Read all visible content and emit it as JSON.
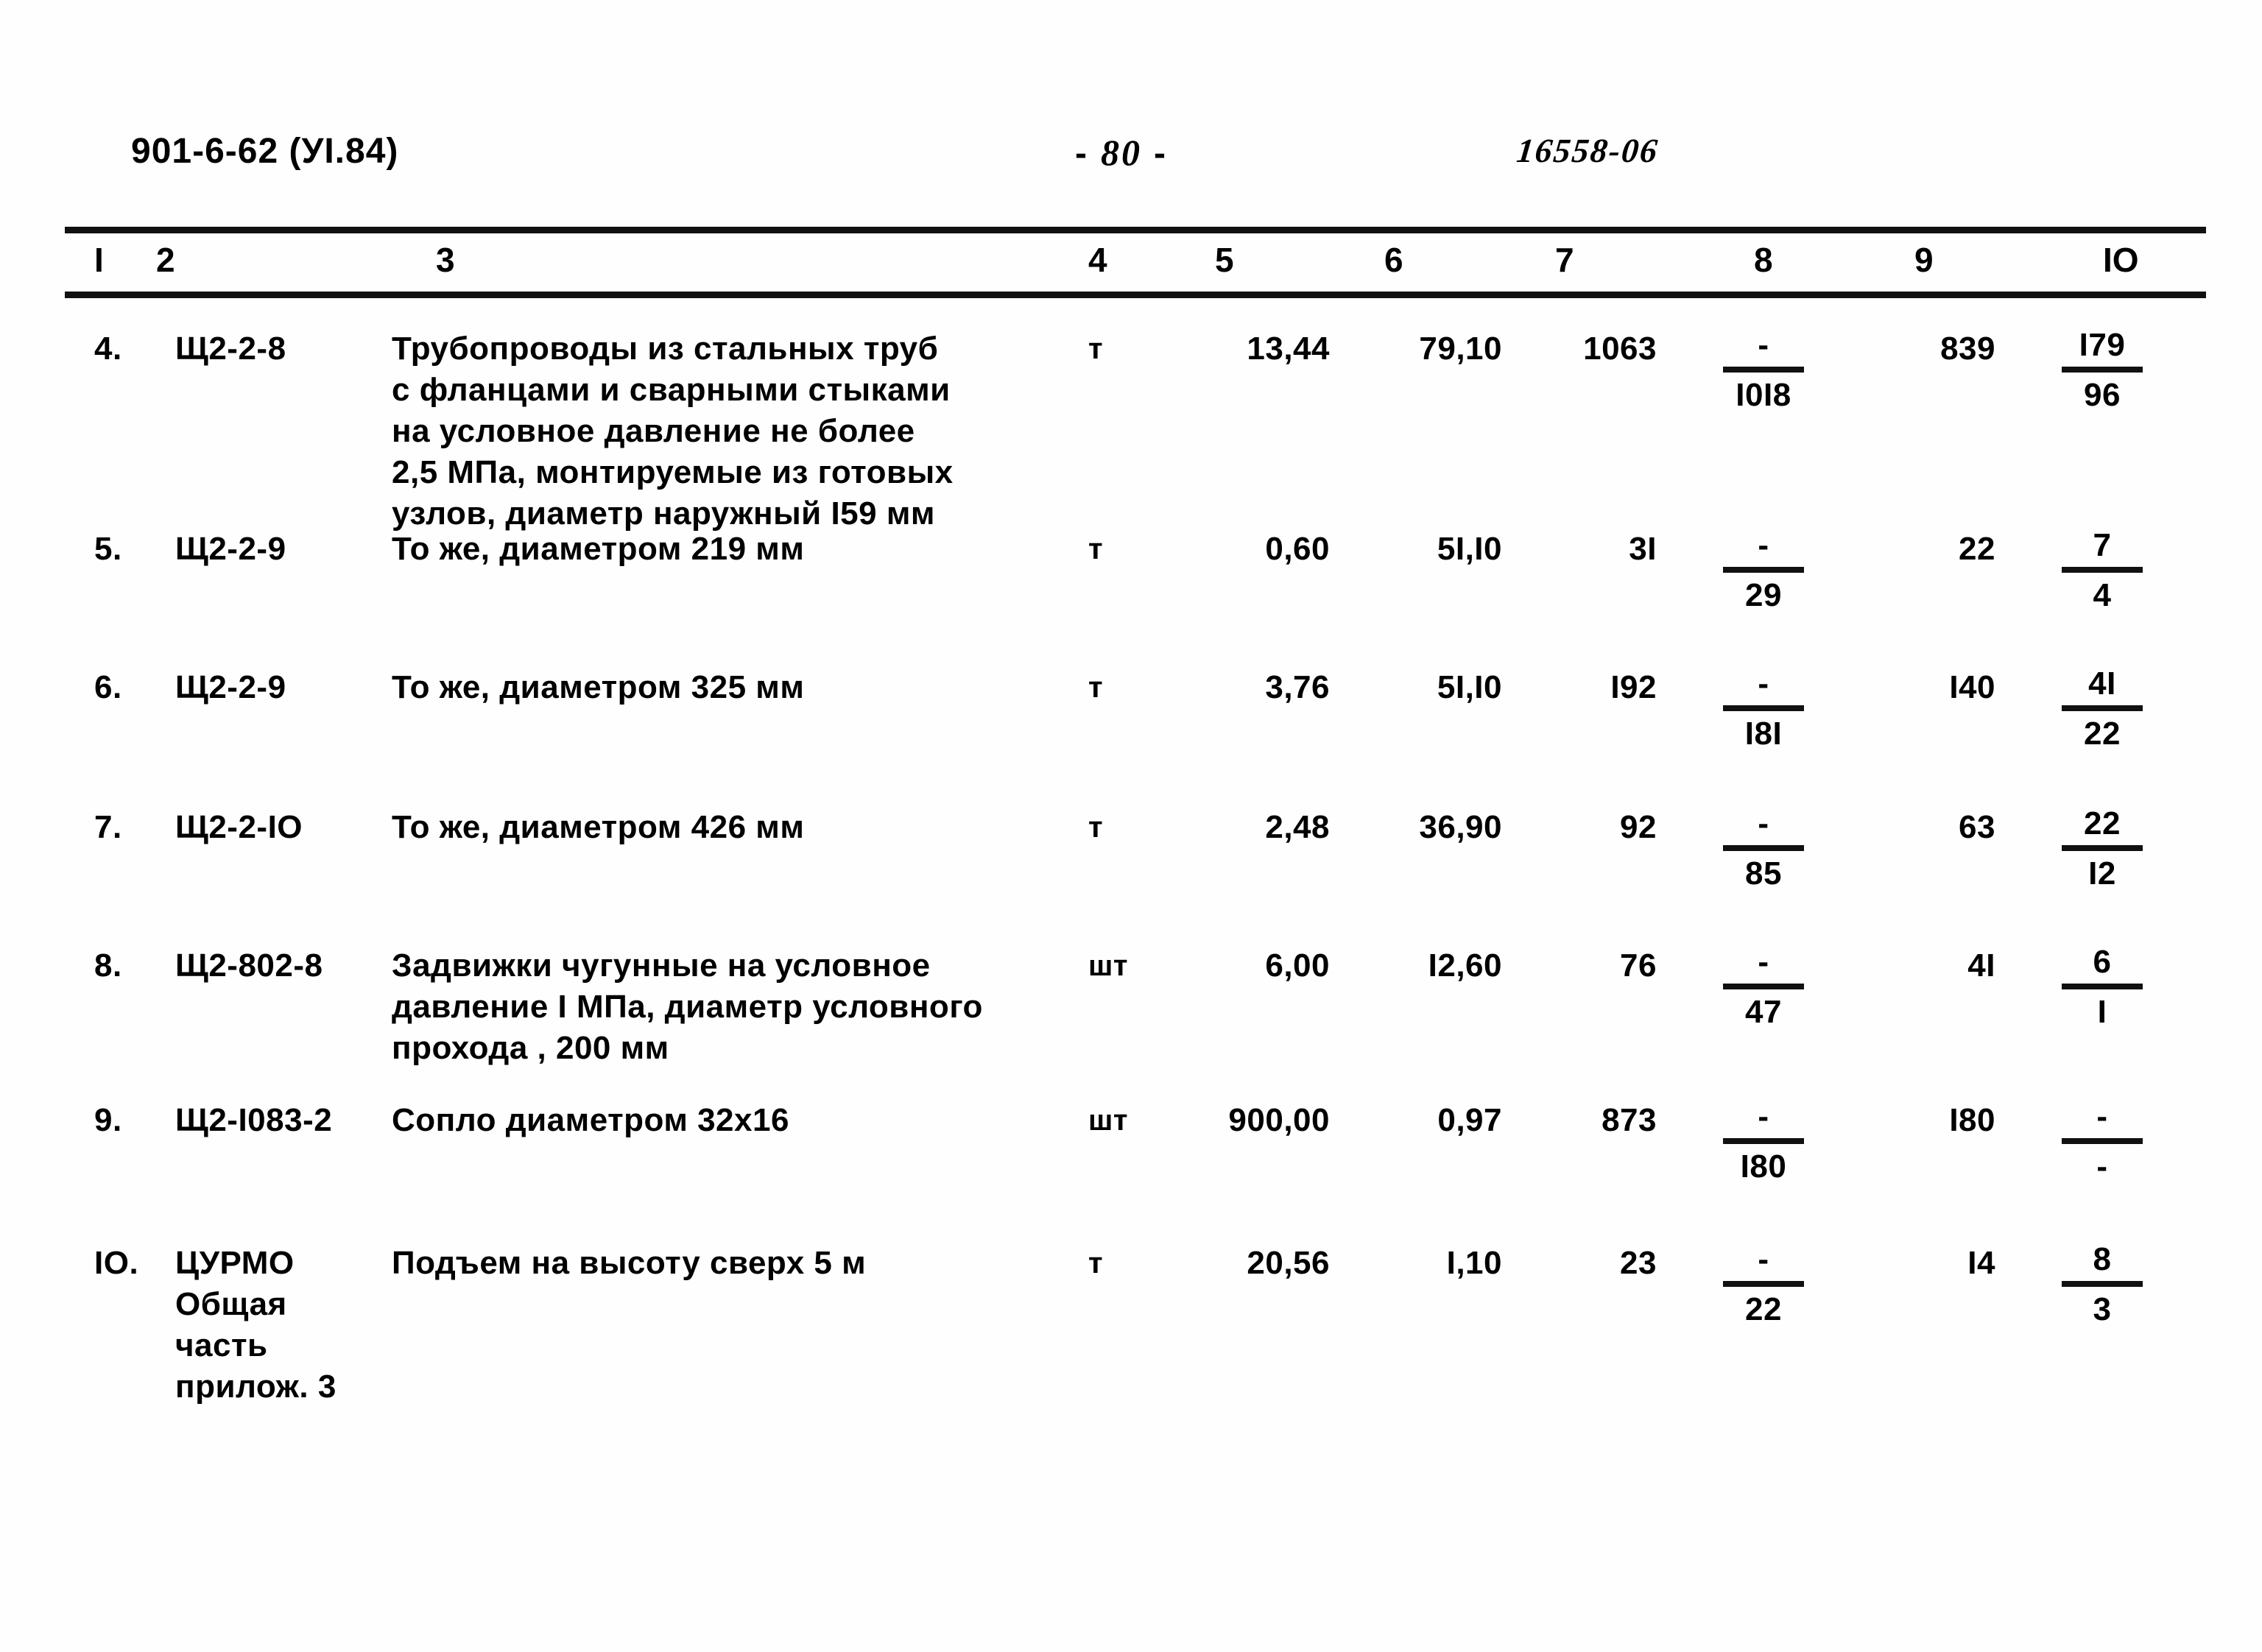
{
  "document": {
    "code": "901-6-62 (УI.84)",
    "page_label": "-",
    "page_number": "80",
    "page_label_end": "-",
    "archive_stamp": "16558-06"
  },
  "table": {
    "column_headers": [
      "I",
      "2",
      "3",
      "4",
      "5",
      "6",
      "7",
      "8",
      "9",
      "IO"
    ],
    "rows": [
      {
        "num": "4.",
        "code": "Щ2-2-8",
        "description": "Трубопроводы из стальных труб\nс фланцами и сварными стыками\nна условное давление не более\n2,5 МПа, монтируемые из готовых\nузлов, диаметр наружный I59 мм",
        "unit": "т",
        "qty": "13,44",
        "price": "79,10",
        "sum": "1063",
        "col8_top": "-",
        "col8_bottom": "I0I8",
        "col9": "839",
        "col10_top": "I79",
        "col10_bottom": "96"
      },
      {
        "num": "5.",
        "code": "Щ2-2-9",
        "description": "То же, диаметром 219 мм",
        "unit": "т",
        "qty": "0,60",
        "price": "5I,I0",
        "sum": "3I",
        "col8_top": "-",
        "col8_bottom": "29",
        "col9": "22",
        "col10_top": "7",
        "col10_bottom": "4"
      },
      {
        "num": "6.",
        "code": "Щ2-2-9",
        "description": "То же, диаметром 325 мм",
        "unit": "т",
        "qty": "3,76",
        "price": "5I,I0",
        "sum": "I92",
        "col8_top": "-",
        "col8_bottom": "I8I",
        "col9": "I40",
        "col10_top": "4I",
        "col10_bottom": "22"
      },
      {
        "num": "7.",
        "code": "Щ2-2-IO",
        "description": "То же, диаметром 426 мм",
        "unit": "т",
        "qty": "2,48",
        "price": "36,90",
        "sum": "92",
        "col8_top": "-",
        "col8_bottom": "85",
        "col9": "63",
        "col10_top": "22",
        "col10_bottom": "I2"
      },
      {
        "num": "8.",
        "code": "Щ2-802-8",
        "description": "Задвижки чугунные на условное\nдавление I МПа, диаметр условного\nпрохода , 200 мм",
        "unit": "шт",
        "qty": "6,00",
        "price": "I2,60",
        "sum": "76",
        "col8_top": "-",
        "col8_bottom": "47",
        "col9": "4I",
        "col10_top": "6",
        "col10_bottom": "I"
      },
      {
        "num": "9.",
        "code": "Щ2-I083-2",
        "description": "Сопло диаметром 32x16",
        "unit": "шт",
        "qty": "900,00",
        "price": "0,97",
        "sum": "873",
        "col8_top": "-",
        "col8_bottom": "I80",
        "col9": "I80",
        "col10_top": "-",
        "col10_bottom": "-"
      },
      {
        "num": "IO.",
        "code": "ЦУРМО\nОбщая\nчасть\nприлож. 3",
        "description": "Подъем на высоту  сверх 5 м",
        "unit": "т",
        "qty": "20,56",
        "price": "I,10",
        "sum": "23",
        "col8_top": "-",
        "col8_bottom": "22",
        "col9": "I4",
        "col10_top": "8",
        "col10_bottom": "3"
      }
    ]
  }
}
